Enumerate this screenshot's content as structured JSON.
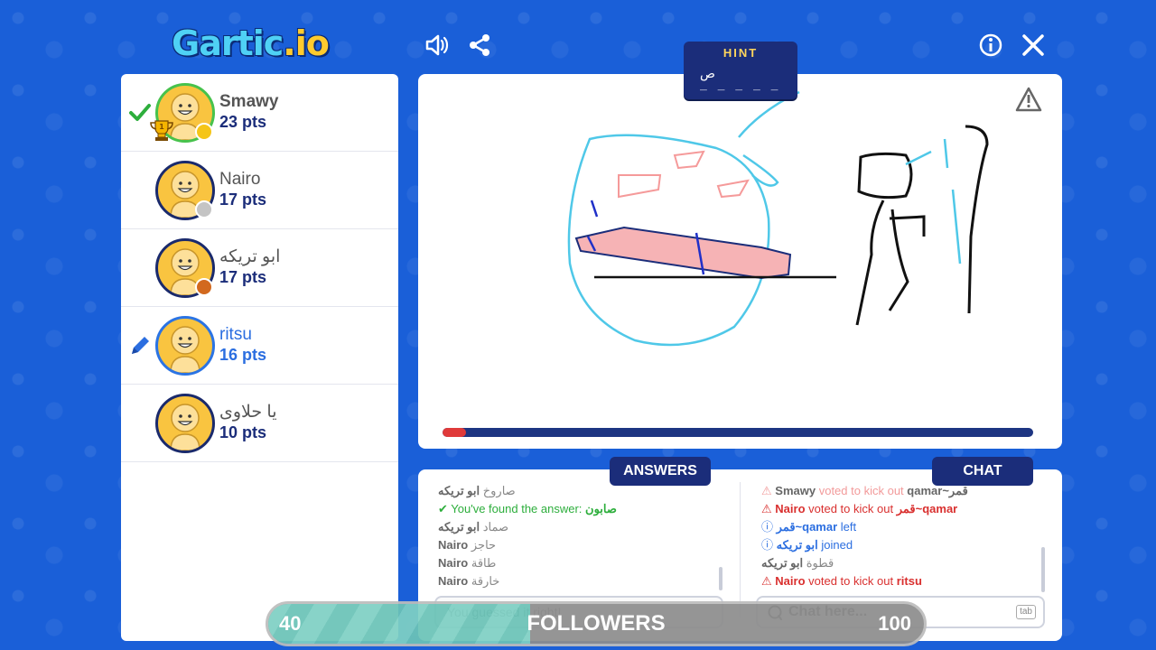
{
  "app": {
    "logo_main": "Gartic",
    "logo_suffix": ".io"
  },
  "top_bar": {
    "icons": [
      "speaker-icon",
      "share-icon",
      "info-icon",
      "close-icon"
    ]
  },
  "players": [
    {
      "name": "Smawy",
      "points": "23 pts",
      "status": "correct",
      "rank_medal": "gold",
      "trophy_rank": "1"
    },
    {
      "name": "Nairo",
      "points": "17 pts",
      "rank_medal": "silver"
    },
    {
      "name": "ابو تريكه",
      "points": "17 pts",
      "rank_medal": "bronze"
    },
    {
      "name": "ritsu",
      "points": "16 pts",
      "status": "drawing"
    },
    {
      "name": "يا حلاوى",
      "points": "10 pts"
    }
  ],
  "hint": {
    "title": "HINT",
    "letter": "ص",
    "blanks": "_ _ _ _ _"
  },
  "timer": {
    "progress": 0.04,
    "color": "#e03a3a"
  },
  "answers": {
    "tab_label": "ANSWERS",
    "messages": [
      {
        "user": "ابو تريكه",
        "text": "صاروخ",
        "type": "normal"
      },
      {
        "text": "You've found the answer:",
        "answer": "صابون",
        "type": "success"
      },
      {
        "user": "ابو تريكه",
        "text": "صماد",
        "type": "normal"
      },
      {
        "user": "Nairo",
        "text": "حاجز",
        "type": "normal"
      },
      {
        "user": "Nairo",
        "text": "طاقة",
        "type": "normal"
      },
      {
        "user": "Nairo",
        "text": "خارقة",
        "type": "normal"
      }
    ],
    "input_placeholder": "You guessed it right!"
  },
  "chat": {
    "tab_label": "CHAT",
    "messages": [
      {
        "user": "Smawy",
        "text": "voted to kick out",
        "target": "qamar~قمر",
        "type": "faded"
      },
      {
        "user": "Nairo",
        "text": "voted to kick out",
        "target": "قمر~qamar",
        "type": "alert"
      },
      {
        "user": "قمر~qamar",
        "text": "left",
        "type": "info"
      },
      {
        "user": "ابو تريكه",
        "text": "joined",
        "type": "info"
      },
      {
        "user": "ابو تريكه",
        "text": "قطوة",
        "type": "normal"
      },
      {
        "user": "Nairo",
        "text": "voted to kick out",
        "target": "ritsu",
        "type": "alert"
      }
    ],
    "input_placeholder": "Chat here...",
    "key_hint": "tab"
  },
  "followers": {
    "current": "40",
    "label": "FOLLOWERS",
    "goal": "100",
    "progress": 0.4
  },
  "colors": {
    "background": "#1a5fd8",
    "navy": "#1b2d7a",
    "success": "#2dae3c",
    "alert": "#d9302f",
    "info": "#2b6ee0",
    "medal_gold": "#f5c518",
    "medal_silver": "#c4c4c4",
    "medal_bronze": "#d2691e"
  }
}
